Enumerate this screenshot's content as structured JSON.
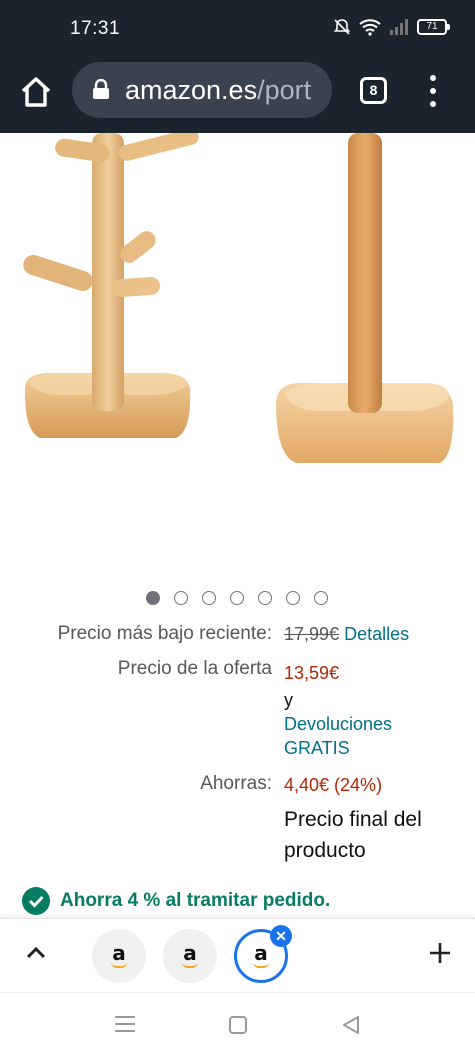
{
  "status_bar": {
    "time": "17:31",
    "battery": "71"
  },
  "browser": {
    "url_host": "amazon.es",
    "url_path": "/port",
    "tab_count": "8"
  },
  "carousel": {
    "dots": 7,
    "active_index": 0
  },
  "price": {
    "recent_low_label": "Precio más bajo reciente:",
    "recent_low_value": "17,99€",
    "details_link": "Detalles",
    "offer_label": "Precio de la oferta",
    "offer_value": "13,59€",
    "and_text": "y",
    "returns_line1": "Devoluciones",
    "returns_line2": "GRATIS",
    "savings_label": "Ahorras:",
    "savings_value": "4,40€ (24%)",
    "final_line1": "Precio final del",
    "final_line2": "producto"
  },
  "promo": {
    "text": "Ahorra 4 % al tramitar pedido."
  },
  "tab_strip": {
    "tab_letters": [
      "a",
      "a",
      "a"
    ],
    "close_glyph": "✕"
  }
}
